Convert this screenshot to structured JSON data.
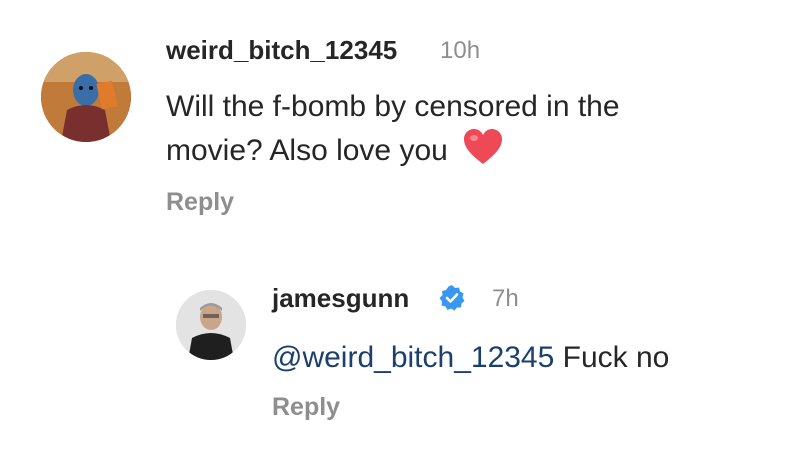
{
  "comments": [
    {
      "username": "weird_bitch_12345",
      "time": "10h",
      "text_line1": "Will the f-bomb by censored in the",
      "text_line2": "movie? Also love you",
      "emoji": "heart-emoji",
      "reply_label": "Reply"
    },
    {
      "username": "jamesgunn",
      "verified": true,
      "time": "7h",
      "mention": "@weird_bitch_12345",
      "text": " Fuck no",
      "reply_label": "Reply"
    }
  ],
  "colors": {
    "username": "#262626",
    "secondary": "#8e8e8e",
    "mention": "#1b3f6e",
    "verified_badge": "#3897f0",
    "heart": "#ed4956"
  }
}
